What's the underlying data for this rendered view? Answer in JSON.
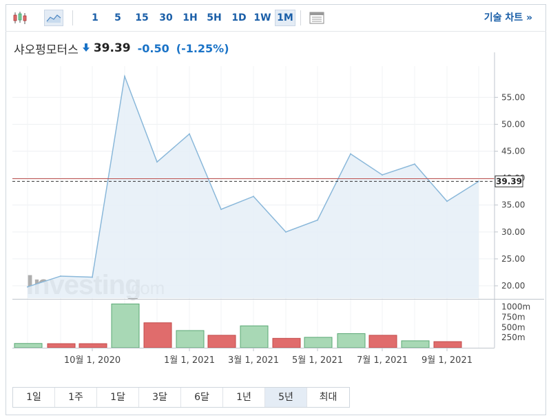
{
  "toolbar": {
    "chart_type_icons": [
      "candlestick-icon",
      "area-chart-icon"
    ],
    "periods": [
      "1",
      "5",
      "15",
      "30",
      "1H",
      "5H",
      "1D",
      "1W",
      "1M"
    ],
    "selected_period": "1M",
    "settings_icon": "table-icon",
    "tech_chart_label": "기술 차트 »"
  },
  "quote": {
    "name": "샤오펑모터스",
    "direction": "down",
    "price": "39.39",
    "change": "-0.50",
    "change_pct": "(-1.25%)",
    "down_color": "#1a73c7"
  },
  "watermark": {
    "brand": "Investing",
    "suffix": ".com"
  },
  "chart_data": {
    "type": "area",
    "x": [
      "2020-08",
      "2020-09",
      "2020-10",
      "2020-11",
      "2020-12",
      "2021-01",
      "2021-02",
      "2021-03",
      "2021-04",
      "2021-05",
      "2021-06",
      "2021-07",
      "2021-08",
      "2021-09",
      "2021-10"
    ],
    "values": [
      19.8,
      21.8,
      21.6,
      58.9,
      43.0,
      48.2,
      34.2,
      36.6,
      30.0,
      32.2,
      44.5,
      40.6,
      42.6,
      35.7,
      39.39
    ],
    "last_price": 39.39,
    "last_price_label": "39.39",
    "reference_price": 39.89,
    "y_ticks": [
      "55.00",
      "50.00",
      "45.00",
      "40.00",
      "35.00",
      "30.00",
      "25.00",
      "20.00"
    ],
    "y_tick_values": [
      55,
      50,
      45,
      40,
      35,
      30,
      25,
      20
    ],
    "ylim": [
      17.7,
      60.8
    ],
    "x_labels": [
      "10월 1, 2020",
      "1월 1, 2021",
      "3월 1, 2021",
      "5월 1, 2021",
      "7월 1, 2021",
      "9월 1, 2021"
    ],
    "x_label_months": [
      "2020-10",
      "2021-01",
      "2021-03",
      "2021-05",
      "2021-07",
      "2021-09"
    ],
    "volume": {
      "values": [
        105,
        100,
        100,
        1070,
        610,
        420,
        305,
        535,
        230,
        255,
        345,
        305,
        170,
        150
      ],
      "directions": [
        "up",
        "down",
        "down",
        "up",
        "down",
        "up",
        "down",
        "up",
        "down",
        "up",
        "up",
        "down",
        "up",
        "down"
      ],
      "ticks": [
        "1000m",
        "750m",
        "500m",
        "250m"
      ],
      "tick_values": [
        1000,
        750,
        500,
        250
      ],
      "ylim": [
        0,
        1160
      ]
    },
    "colors": {
      "line": "#8ab8da",
      "fill": "#e5eef7",
      "vol_up": "#a8d8b5",
      "vol_up_stroke": "#5aa874",
      "vol_down": "#e06c6c",
      "vol_down_stroke": "#c24a4a",
      "price_line": "#c0504d"
    },
    "grid": true
  },
  "ranges": [
    "1일",
    "1주",
    "1달",
    "3달",
    "6달",
    "1년",
    "5년",
    "최대"
  ],
  "selected_range": "5년"
}
